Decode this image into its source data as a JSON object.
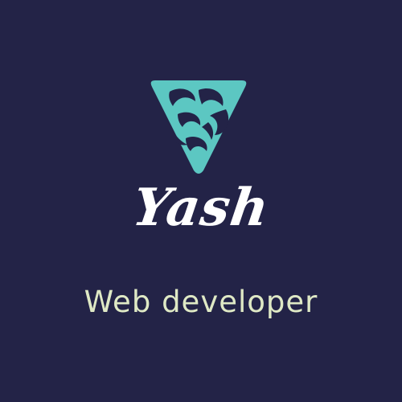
{
  "brand": {
    "name": "Yash",
    "tagline": "Web developer",
    "emblem_icon": "swirl-triangle-icon"
  },
  "colors": {
    "background": "#232347",
    "emblem_fill": "#5cc7c2",
    "emblem_cut": "#232347",
    "name_text": "#ffffff",
    "tagline_text": "#dfe9c5"
  }
}
